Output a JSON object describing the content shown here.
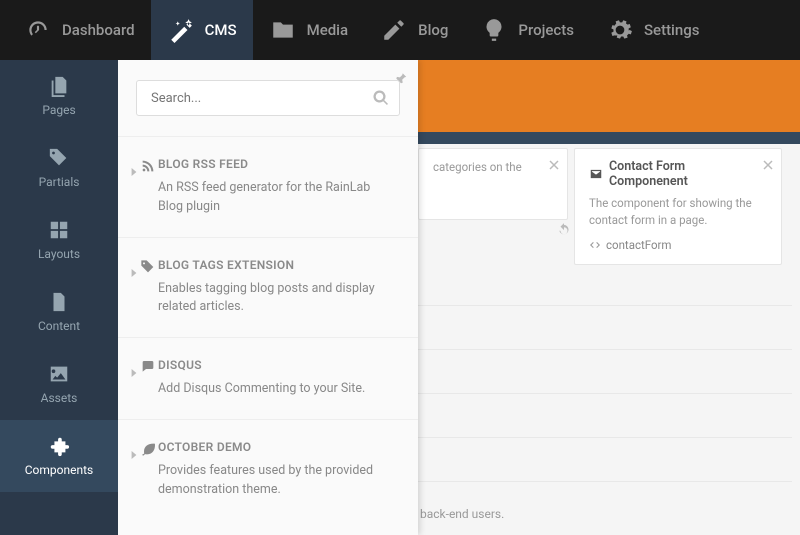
{
  "topnav": [
    {
      "label": "Dashboard",
      "active": false
    },
    {
      "label": "CMS",
      "active": true
    },
    {
      "label": "Media",
      "active": false
    },
    {
      "label": "Blog",
      "active": false
    },
    {
      "label": "Projects",
      "active": false
    },
    {
      "label": "Settings",
      "active": false
    }
  ],
  "sidebar": [
    {
      "label": "Pages",
      "active": false
    },
    {
      "label": "Partials",
      "active": false
    },
    {
      "label": "Layouts",
      "active": false
    },
    {
      "label": "Content",
      "active": false
    },
    {
      "label": "Assets",
      "active": false
    },
    {
      "label": "Components",
      "active": true
    }
  ],
  "search": {
    "placeholder": "Search..."
  },
  "components": [
    {
      "title": "BLOG RSS FEED",
      "desc": "An RSS feed generator for the RainLab Blog plugin"
    },
    {
      "title": "BLOG TAGS EXTENSION",
      "desc": "Enables tagging blog posts and display related articles."
    },
    {
      "title": "DISQUS",
      "desc": "Add Disqus Commenting to your Site."
    },
    {
      "title": "OCTOBER DEMO",
      "desc": "Provides features used by the provided demonstration theme."
    }
  ],
  "card_a": {
    "desc": "categories on the"
  },
  "card_b": {
    "title": "Contact Form Componenent",
    "desc": "The component for showing the contact form in a page.",
    "alias": "contactForm"
  },
  "background_text": "back-end users."
}
